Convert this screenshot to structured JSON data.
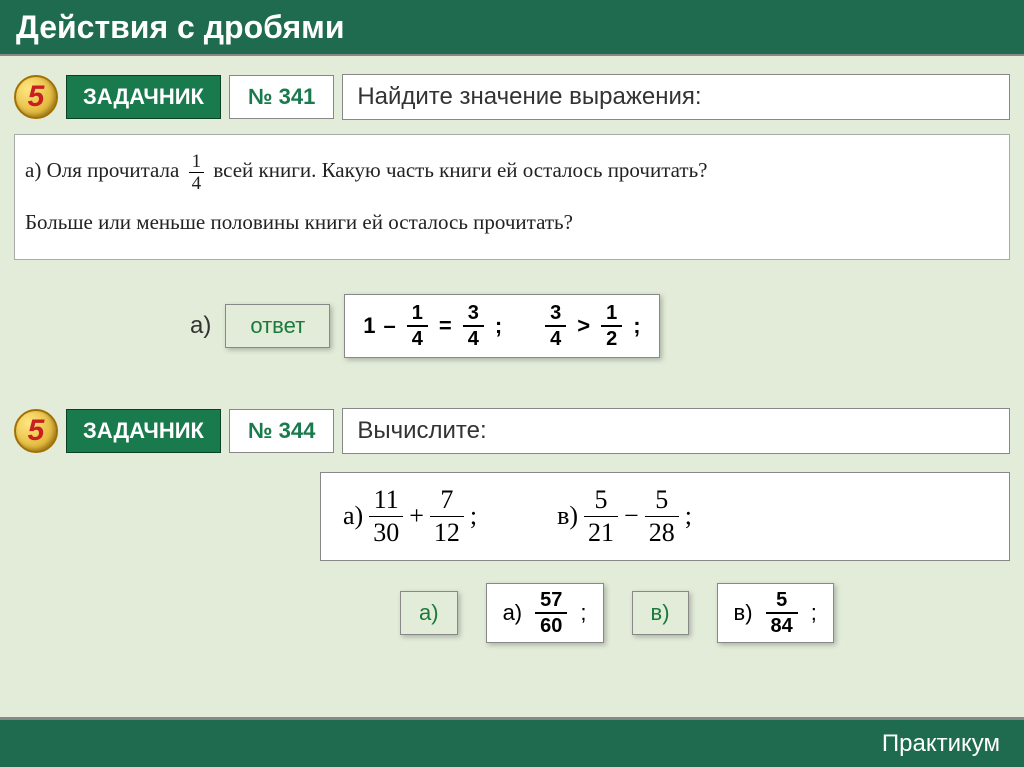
{
  "title": "Действия с дробями",
  "task1": {
    "badge_label": "ЗАДАЧНИК",
    "number": "№ 341",
    "prompt": "Найдите значение выражения:",
    "q_prefix": "а) Оля прочитала",
    "q_frac_num": "1",
    "q_frac_den": "4",
    "q_mid": "всей книги. Какую часть книги ей осталось прочитать?",
    "q_line2": "Больше или меньше половины книги ей осталось прочитать?",
    "answer_letter": "а)",
    "answer_btn": "ответ",
    "ans": {
      "one": "1",
      "minus": "–",
      "eq": "=",
      "semi": ";",
      "gt": ">",
      "f1n": "1",
      "f1d": "4",
      "f2n": "3",
      "f2d": "4",
      "f3n": "3",
      "f3d": "4",
      "f4n": "1",
      "f4d": "2"
    }
  },
  "task2": {
    "badge_label": "ЗАДАЧНИК",
    "number": "№ 344",
    "prompt": "Вычислите:",
    "calcA": {
      "label": "а)",
      "n1": "11",
      "d1": "30",
      "op": "+",
      "n2": "7",
      "d2": "12",
      "end": ";"
    },
    "calcV": {
      "label": "в)",
      "n1": "5",
      "d1": "21",
      "op": "−",
      "n2": "5",
      "d2": "28",
      "end": ";"
    },
    "btnA": "а)",
    "btnV": "в)",
    "ansA": {
      "label": "а)",
      "n": "57",
      "d": "60",
      "semi": ";"
    },
    "ansV": {
      "label": "в)",
      "n": "5",
      "d": "84",
      "semi": ";"
    }
  },
  "footer": "Практикум",
  "badge_digit": "5"
}
